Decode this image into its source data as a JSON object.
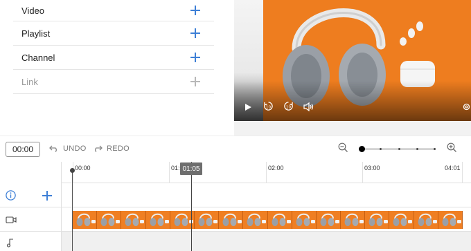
{
  "add_items": [
    {
      "label": "Video",
      "disabled": false
    },
    {
      "label": "Playlist",
      "disabled": false
    },
    {
      "label": "Channel",
      "disabled": false
    },
    {
      "label": "Link",
      "disabled": true
    }
  ],
  "toolbar": {
    "time": "00:00",
    "undo_label": "UNDO",
    "redo_label": "REDO"
  },
  "timeline": {
    "ticks": [
      "00:00",
      "01:00",
      "02:00",
      "03:00",
      "04:01"
    ],
    "playhead": "01:05"
  },
  "colors": {
    "accent": "#3d7fd6",
    "thumbnail": "#ee7d1f"
  }
}
